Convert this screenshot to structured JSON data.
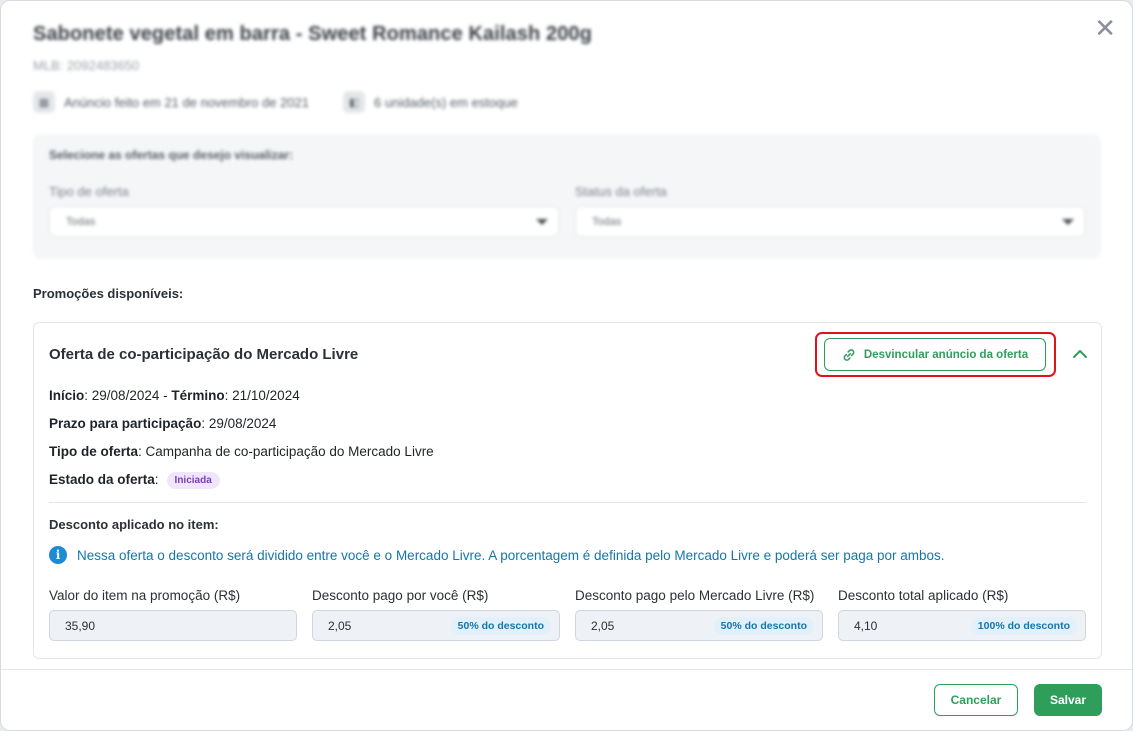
{
  "header": {
    "title": "Sabonete vegetal em barra - Sweet Romance Kailash 200g",
    "mlb": "MLB: 2092483650",
    "listed_text": "Anúncio feito em 21 de novembro de 2021",
    "stock_text": "6 unidade(s) em estoque"
  },
  "filters": {
    "title": "Selecione as ofertas que desejo visualizar:",
    "offer_type_label": "Tipo de oferta",
    "offer_type_value": "Todas",
    "offer_status_label": "Status da oferta",
    "offer_status_value": "Todas"
  },
  "promotions": {
    "section_title": "Promoções disponíveis:",
    "card": {
      "title": "Oferta de co-participação do Mercado Livre",
      "unlink_label": "Desvincular anúncio da oferta",
      "start_label": "Início",
      "start_value": "29/08/2024",
      "end_label": "Término",
      "end_value": "21/10/2024",
      "deadline_label": "Prazo para participação",
      "deadline_value": "29/08/2024",
      "type_label": "Tipo de oferta",
      "type_value": "Campanha de co-participação do Mercado Livre",
      "status_label": "Estado da oferta",
      "status_badge": "Iniciada",
      "discount_title": "Desconto aplicado no item:",
      "notice": "Nessa oferta o desconto será dividido entre você e o Mercado Livre. A porcentagem é definida pelo Mercado Livre e poderá ser paga por ambos.",
      "fields": [
        {
          "label": "Valor do item na promoção (R$)",
          "value": "35,90",
          "pct": ""
        },
        {
          "label": "Desconto pago por você (R$)",
          "value": "2,05",
          "pct": "50% do desconto"
        },
        {
          "label": "Desconto pago pelo Mercado Livre (R$)",
          "value": "2,05",
          "pct": "50% do desconto"
        },
        {
          "label": "Desconto total aplicado (R$)",
          "value": "4,10",
          "pct": "100% do desconto"
        }
      ]
    }
  },
  "footer": {
    "cancel_label": "Cancelar",
    "save_label": "Salvar"
  },
  "colors": {
    "accent": "#2f9e5b",
    "highlight": "#e0121a",
    "info": "#1576a8",
    "badge": "#7b3cc4"
  }
}
